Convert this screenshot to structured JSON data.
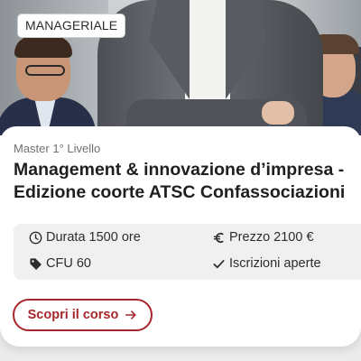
{
  "card": {
    "badge": "MANAGERIALE",
    "level": "Master 1° Livello",
    "title": "Management & innovazione d’impresa - Edizione coorte ATSC Confassociazioni",
    "info": {
      "duration": "Durata 1500 ore",
      "price": "Prezzo 2100 €",
      "credits": "CFU 60",
      "enrollment": "Iscrizioni aperte"
    },
    "cta_label": "Scopri il corso",
    "icons": {
      "duration": "clock-icon",
      "price": "euro-icon",
      "credits": "tag-icon",
      "enrollment": "check-icon",
      "cta": "arrow-right-icon"
    },
    "colors": {
      "accent": "#a8252b",
      "info_bg": "#f0f0f0"
    }
  }
}
